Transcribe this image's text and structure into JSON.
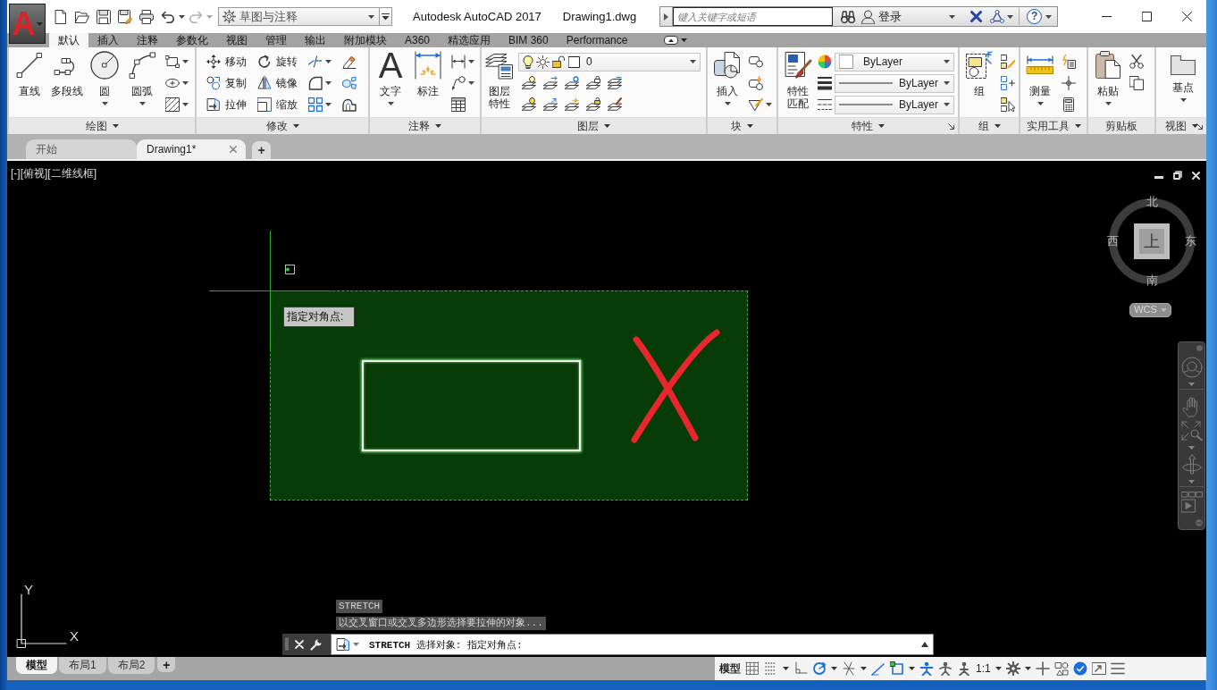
{
  "window": {
    "title": "Autodesk AutoCAD 2017",
    "document": "Drawing1.dwg"
  },
  "app_menu": {
    "logo": "A"
  },
  "quick_access": {
    "workspace": "草图与注释"
  },
  "search": {
    "placeholder": "键入关键字或短语",
    "sign_in": "登录",
    "help": "?"
  },
  "ribbon_tabs": [
    {
      "label": "默认",
      "selected": true
    },
    {
      "label": "插入",
      "selected": false
    },
    {
      "label": "注释",
      "selected": false
    },
    {
      "label": "参数化",
      "selected": false
    },
    {
      "label": "视图",
      "selected": false
    },
    {
      "label": "管理",
      "selected": false
    },
    {
      "label": "输出",
      "selected": false
    },
    {
      "label": "附加模块",
      "selected": false
    },
    {
      "label": "A360",
      "selected": false
    },
    {
      "label": "精选应用",
      "selected": false
    },
    {
      "label": "BIM 360",
      "selected": false
    },
    {
      "label": "Performance",
      "selected": false
    }
  ],
  "ribbon_panels": [
    {
      "title": "绘图",
      "menu": true,
      "launcher": false,
      "items": [
        {
          "kind": "large",
          "label": "直线",
          "dropdown": false
        },
        {
          "kind": "large",
          "label": "多段线",
          "dropdown": false
        },
        {
          "kind": "large",
          "label": "圆",
          "dropdown": true
        },
        {
          "kind": "large",
          "label": "圆弧",
          "dropdown": true
        },
        {
          "kind": "stack",
          "rows": [
            [
              {
                "kind": "icon",
                "dropdown": true
              }
            ],
            [
              {
                "kind": "icon",
                "dropdown": true
              }
            ],
            [
              {
                "kind": "icon",
                "dropdown": true
              }
            ]
          ]
        }
      ]
    },
    {
      "title": "修改",
      "menu": true,
      "launcher": false,
      "items": [
        {
          "kind": "stack",
          "rows": [
            [
              {
                "kind": "small",
                "label": "移动",
                "dropdown": false
              },
              {
                "kind": "small",
                "label": "旋转",
                "dropdown": false
              },
              {
                "kind": "icon",
                "dropdown": true
              },
              {
                "kind": "icon",
                "dropdown": false
              }
            ],
            [
              {
                "kind": "small",
                "label": "复制",
                "dropdown": false
              },
              {
                "kind": "small",
                "label": "镜像",
                "dropdown": false
              },
              {
                "kind": "icon",
                "dropdown": true
              },
              {
                "kind": "icon",
                "dropdown": false
              }
            ],
            [
              {
                "kind": "small",
                "label": "拉伸",
                "dropdown": false
              },
              {
                "kind": "small",
                "label": "缩放",
                "dropdown": false
              },
              {
                "kind": "icon",
                "dropdown": true
              },
              {
                "kind": "icon",
                "dropdown": false
              }
            ]
          ]
        }
      ]
    },
    {
      "title": "注释",
      "menu": true,
      "launcher": false,
      "items": [
        {
          "kind": "large",
          "label": "文字",
          "glyph": "A",
          "dropdown": true
        },
        {
          "kind": "large",
          "label": "标注",
          "dropdown": false
        },
        {
          "kind": "stack",
          "rows": [
            [
              {
                "kind": "icon",
                "dropdown": true
              }
            ],
            [
              {
                "kind": "icon",
                "dropdown": true
              }
            ],
            [
              {
                "kind": "icon",
                "dropdown": false
              }
            ]
          ]
        }
      ]
    },
    {
      "title": "图层",
      "menu": true,
      "launcher": false,
      "items": [
        {
          "kind": "large",
          "label": "图层特性",
          "dropdown": false
        },
        {
          "kind": "stack",
          "rows": [
            [
              {
                "kind": "layer-combo",
                "value": "0"
              }
            ],
            [
              {
                "kind": "icon",
                "dropdown": false
              },
              {
                "kind": "icon",
                "dropdown": false
              },
              {
                "kind": "icon",
                "dropdown": false
              },
              {
                "kind": "icon",
                "dropdown": false
              },
              {
                "kind": "icon",
                "dropdown": false
              }
            ],
            [
              {
                "kind": "icon",
                "dropdown": false
              },
              {
                "kind": "icon",
                "dropdown": false
              },
              {
                "kind": "icon",
                "dropdown": false
              },
              {
                "kind": "icon",
                "dropdown": false
              },
              {
                "kind": "icon",
                "dropdown": false
              }
            ]
          ]
        }
      ]
    },
    {
      "title": "块",
      "menu": true,
      "launcher": false,
      "items": [
        {
          "kind": "large",
          "label": "插入",
          "dropdown": true
        },
        {
          "kind": "stack",
          "rows": [
            [
              {
                "kind": "icon",
                "dropdown": false
              }
            ],
            [
              {
                "kind": "icon",
                "dropdown": false
              }
            ],
            [
              {
                "kind": "icon",
                "dropdown": true
              }
            ]
          ]
        }
      ]
    },
    {
      "title": "特性",
      "menu": true,
      "launcher": true,
      "items": [
        {
          "kind": "large",
          "label": "特性匹配",
          "dropdown": false
        },
        {
          "kind": "stack",
          "rows": [
            [
              {
                "kind": "icon",
                "dropdown": false
              },
              {
                "kind": "color-combo",
                "value": "ByLayer"
              }
            ],
            [
              {
                "kind": "icon",
                "dropdown": false
              },
              {
                "kind": "line-combo",
                "value": "ByLayer"
              }
            ],
            [
              {
                "kind": "icon",
                "dropdown": false
              },
              {
                "kind": "line-combo",
                "value": "ByLayer"
              }
            ]
          ]
        }
      ]
    },
    {
      "title": "组",
      "menu": true,
      "launcher": false,
      "items": [
        {
          "kind": "large",
          "label": "组",
          "dropdown": false
        },
        {
          "kind": "stack",
          "rows": [
            [
              {
                "kind": "icon",
                "dropdown": false
              }
            ],
            [
              {
                "kind": "icon",
                "dropdown": false
              }
            ],
            [
              {
                "kind": "icon",
                "dropdown": false
              }
            ]
          ]
        }
      ]
    },
    {
      "title": "实用工具",
      "menu": true,
      "launcher": false,
      "items": [
        {
          "kind": "large",
          "label": "测量",
          "dropdown": true
        },
        {
          "kind": "stack",
          "rows": [
            [
              {
                "kind": "icon",
                "dropdown": false
              }
            ],
            [
              {
                "kind": "icon",
                "dropdown": false
              }
            ],
            [
              {
                "kind": "icon",
                "dropdown": false
              }
            ]
          ]
        }
      ]
    },
    {
      "title": "剪贴板",
      "menu": false,
      "launcher": false,
      "items": [
        {
          "kind": "large",
          "label": "粘贴",
          "dropdown": true
        },
        {
          "kind": "stack",
          "rows": [
            [
              {
                "kind": "icon",
                "dropdown": false
              }
            ],
            [
              {
                "kind": "icon",
                "dropdown": false
              }
            ]
          ]
        }
      ]
    },
    {
      "title": "视图",
      "menu": true,
      "launcher": true,
      "items": [
        {
          "kind": "large",
          "label": "基点",
          "dropdown": true
        }
      ]
    }
  ],
  "file_tabs": [
    {
      "label": "开始",
      "selected": false,
      "closable": false
    },
    {
      "label": "Drawing1*",
      "selected": true,
      "closable": true
    }
  ],
  "new_tab": "+",
  "viewport": {
    "controls": [
      "[-]",
      "[俯视]",
      "[二维线框]"
    ],
    "tooltip": "指定对角点:"
  },
  "viewcube": {
    "north": "北",
    "west": "西",
    "east": "东",
    "south": "南",
    "face": "上",
    "ucs": "WCS"
  },
  "ucs_icon": {
    "y": "Y",
    "x": "X"
  },
  "command": {
    "history": [
      "STRETCH",
      "以交叉窗口或交叉多边形选择要拉伸的对象..."
    ],
    "prompt": "**STRETCH** 选择对象: 指定对角点:"
  },
  "layout_tabs": [
    {
      "label": "模型",
      "selected": true
    },
    {
      "label": "布局1",
      "selected": false
    },
    {
      "label": "布局2",
      "selected": false
    }
  ],
  "new_layout": "+",
  "status_bar": {
    "items": [
      {
        "kind": "text",
        "label": "模型",
        "dropdown": false
      },
      {
        "kind": "toggle",
        "on": false,
        "dropdown": false
      },
      {
        "kind": "toggle",
        "on": false,
        "dropdown": true
      },
      {
        "kind": "toggle",
        "on": false,
        "dropdown": false
      },
      {
        "kind": "toggle",
        "on": true,
        "dropdown": true
      },
      {
        "kind": "toggle",
        "on": false,
        "dropdown": true
      },
      {
        "kind": "toggle",
        "on": true,
        "dropdown": false
      },
      {
        "kind": "toggle",
        "on": true,
        "dropdown": true
      },
      {
        "kind": "toggle",
        "on": true,
        "dropdown": false
      },
      {
        "kind": "toggle",
        "on": false,
        "dropdown": false
      },
      {
        "kind": "toggle",
        "on": false,
        "dropdown": false
      },
      {
        "kind": "text",
        "label": "1:1",
        "dropdown": true
      },
      {
        "kind": "toggle",
        "on": false,
        "dropdown": true
      },
      {
        "kind": "toggle",
        "on": false,
        "dropdown": false
      },
      {
        "kind": "toggle",
        "on": false,
        "dropdown": false
      },
      {
        "kind": "toggle",
        "on": true,
        "dropdown": false
      },
      {
        "kind": "toggle",
        "on": false,
        "dropdown": false
      },
      {
        "kind": "toggle",
        "on": false,
        "dropdown": false
      }
    ]
  }
}
